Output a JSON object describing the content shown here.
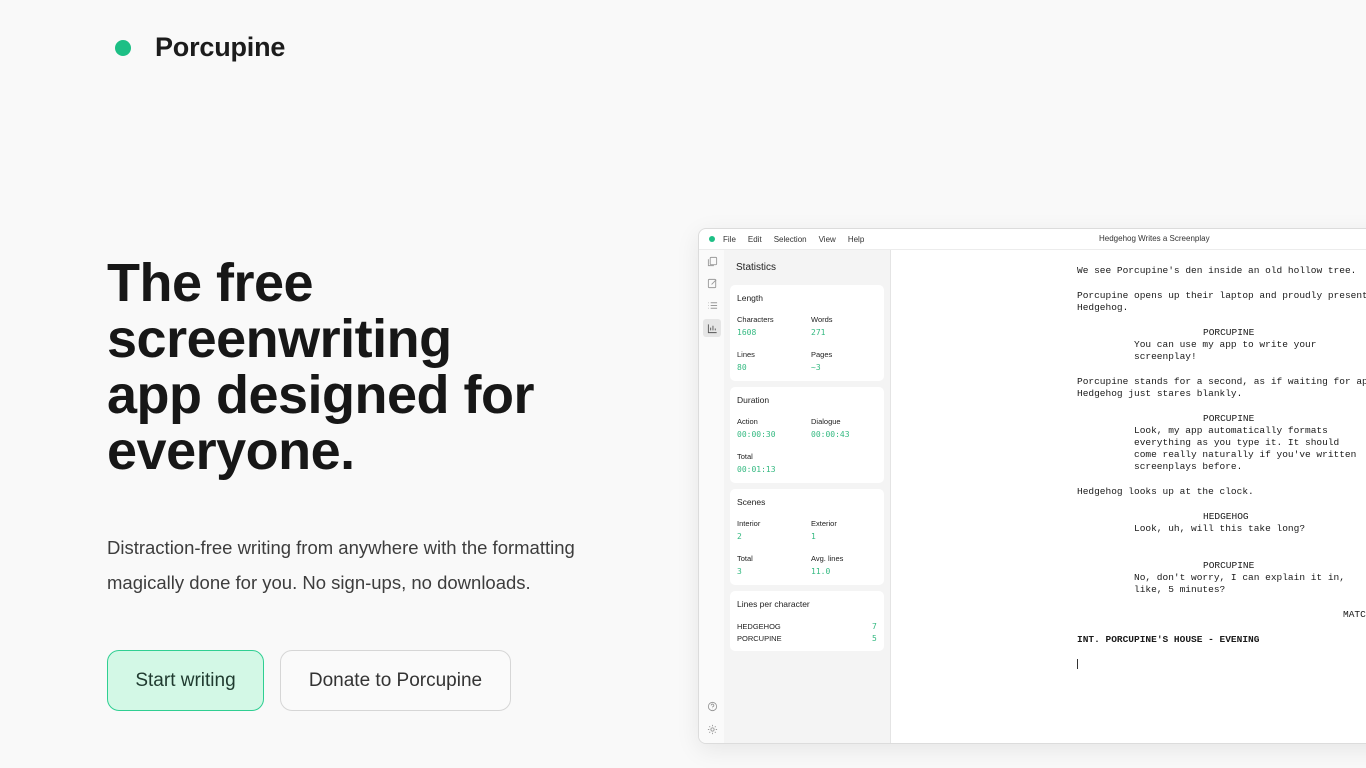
{
  "brand": {
    "name": "Porcupine",
    "accent": "#1dbf85"
  },
  "hero": {
    "title_lines": [
      "The free",
      "screenwriting",
      "app designed for",
      "everyone."
    ],
    "subtitle_lines": [
      "Distraction-free writing from anywhere with the formatting",
      "magically done for you. No sign-ups, no downloads."
    ]
  },
  "buttons": {
    "primary": "Start writing",
    "secondary": "Donate to Porcupine"
  },
  "app": {
    "menu": [
      "File",
      "Edit",
      "Selection",
      "View",
      "Help"
    ],
    "document_title": "Hedgehog Writes a Screenplay",
    "sidebar_icons": [
      "copy-icon",
      "edit-icon",
      "outline-icon",
      "stats-icon",
      "help-icon",
      "settings-icon"
    ],
    "stats": {
      "title": "Statistics",
      "length": {
        "title": "Length",
        "characters_label": "Characters",
        "characters": "1608",
        "words_label": "Words",
        "words": "271",
        "lines_label": "Lines",
        "lines": "80",
        "pages_label": "Pages",
        "pages": "~3"
      },
      "duration": {
        "title": "Duration",
        "action_label": "Action",
        "action": "00:00:30",
        "dialogue_label": "Dialogue",
        "dialogue": "00:00:43",
        "total_label": "Total",
        "total": "00:01:13"
      },
      "scenes": {
        "title": "Scenes",
        "interior_label": "Interior",
        "interior": "2",
        "exterior_label": "Exterior",
        "exterior": "1",
        "total_label": "Total",
        "total": "3",
        "avg_label": "Avg. lines",
        "avg": "11.0"
      },
      "lines_per_character": {
        "title": "Lines per character",
        "rows": [
          {
            "name": "HEDGEHOG",
            "count": "7"
          },
          {
            "name": "PORCUPINE",
            "count": "5"
          }
        ]
      }
    },
    "script_lines": [
      "We see Porcupine's den inside an old hollow tree.",
      "Porcupine opens up their laptop and proudly presents it to",
      "Hedgehog.",
      "PORCUPINE",
      "You can use my app to write your",
      "screenplay!",
      "Porcupine stands for a second, as if waiting for applause.",
      "Hedgehog just stares blankly.",
      "PORCUPINE",
      "Look, my app automatically formats",
      "everything as you type it. It should",
      "come really naturally if you've written",
      "screenplays before.",
      "Hedgehog looks up at the clock.",
      "HEDGEHOG",
      "Look, uh, will this take long?",
      "PORCUPINE",
      "No, don't worry, I can explain it in,",
      "like, 5 minutes?",
      "MATCH CUT TO:",
      "INT. PORCUPINE'S HOUSE - EVENING"
    ]
  }
}
